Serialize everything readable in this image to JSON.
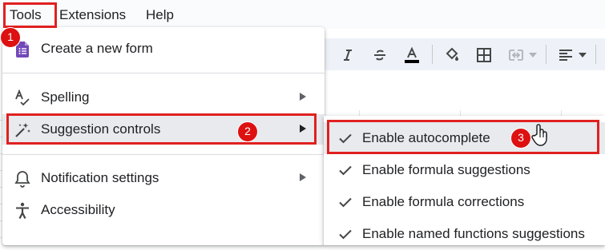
{
  "menubar": {
    "items": [
      "Tools",
      "Extensions",
      "Help"
    ]
  },
  "tools_menu": {
    "items": [
      {
        "label": "Create a new form",
        "icon": "forms-icon",
        "has_submenu": false
      },
      {
        "label": "Spelling",
        "icon": "spelling-icon",
        "has_submenu": true
      },
      {
        "label": "Suggestion controls",
        "icon": "magic-wand-icon",
        "has_submenu": true
      },
      {
        "label": "Notification settings",
        "icon": "bell-icon",
        "has_submenu": true
      },
      {
        "label": "Accessibility",
        "icon": "accessibility-icon",
        "has_submenu": false
      }
    ]
  },
  "suggestion_submenu": {
    "items": [
      {
        "label": "Enable autocomplete",
        "checked": true
      },
      {
        "label": "Enable formula suggestions",
        "checked": true
      },
      {
        "label": "Enable formula corrections",
        "checked": true
      },
      {
        "label": "Enable named functions suggestions",
        "checked": true
      }
    ]
  },
  "annotations": {
    "step_1": "1",
    "step_2": "2",
    "step_3": "3",
    "highlight_color": "#e02020"
  },
  "toolbar": {
    "icons": [
      "italic-icon",
      "strikethrough-icon",
      "text-color-icon",
      "fill-color-icon",
      "borders-icon",
      "merge-cells-icon",
      "align-icon"
    ]
  },
  "colors": {
    "menu_hover": "#e8eaed",
    "toolbar_bg": "#eef2f8",
    "menubar_bg": "#f9fbfd",
    "forms_purple": "#7248b9"
  }
}
